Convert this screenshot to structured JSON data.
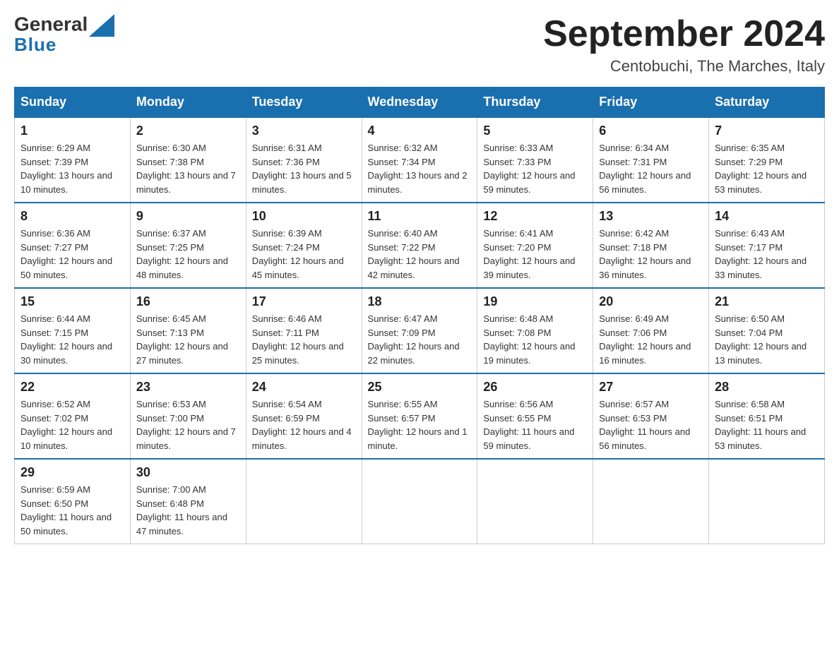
{
  "logo": {
    "general": "General",
    "blue": "Blue"
  },
  "header": {
    "title": "September 2024",
    "subtitle": "Centobuchi, The Marches, Italy"
  },
  "weekdays": [
    "Sunday",
    "Monday",
    "Tuesday",
    "Wednesday",
    "Thursday",
    "Friday",
    "Saturday"
  ],
  "weeks": [
    [
      {
        "day": "1",
        "sunrise": "6:29 AM",
        "sunset": "7:39 PM",
        "daylight": "13 hours and 10 minutes."
      },
      {
        "day": "2",
        "sunrise": "6:30 AM",
        "sunset": "7:38 PM",
        "daylight": "13 hours and 7 minutes."
      },
      {
        "day": "3",
        "sunrise": "6:31 AM",
        "sunset": "7:36 PM",
        "daylight": "13 hours and 5 minutes."
      },
      {
        "day": "4",
        "sunrise": "6:32 AM",
        "sunset": "7:34 PM",
        "daylight": "13 hours and 2 minutes."
      },
      {
        "day": "5",
        "sunrise": "6:33 AM",
        "sunset": "7:33 PM",
        "daylight": "12 hours and 59 minutes."
      },
      {
        "day": "6",
        "sunrise": "6:34 AM",
        "sunset": "7:31 PM",
        "daylight": "12 hours and 56 minutes."
      },
      {
        "day": "7",
        "sunrise": "6:35 AM",
        "sunset": "7:29 PM",
        "daylight": "12 hours and 53 minutes."
      }
    ],
    [
      {
        "day": "8",
        "sunrise": "6:36 AM",
        "sunset": "7:27 PM",
        "daylight": "12 hours and 50 minutes."
      },
      {
        "day": "9",
        "sunrise": "6:37 AM",
        "sunset": "7:25 PM",
        "daylight": "12 hours and 48 minutes."
      },
      {
        "day": "10",
        "sunrise": "6:39 AM",
        "sunset": "7:24 PM",
        "daylight": "12 hours and 45 minutes."
      },
      {
        "day": "11",
        "sunrise": "6:40 AM",
        "sunset": "7:22 PM",
        "daylight": "12 hours and 42 minutes."
      },
      {
        "day": "12",
        "sunrise": "6:41 AM",
        "sunset": "7:20 PM",
        "daylight": "12 hours and 39 minutes."
      },
      {
        "day": "13",
        "sunrise": "6:42 AM",
        "sunset": "7:18 PM",
        "daylight": "12 hours and 36 minutes."
      },
      {
        "day": "14",
        "sunrise": "6:43 AM",
        "sunset": "7:17 PM",
        "daylight": "12 hours and 33 minutes."
      }
    ],
    [
      {
        "day": "15",
        "sunrise": "6:44 AM",
        "sunset": "7:15 PM",
        "daylight": "12 hours and 30 minutes."
      },
      {
        "day": "16",
        "sunrise": "6:45 AM",
        "sunset": "7:13 PM",
        "daylight": "12 hours and 27 minutes."
      },
      {
        "day": "17",
        "sunrise": "6:46 AM",
        "sunset": "7:11 PM",
        "daylight": "12 hours and 25 minutes."
      },
      {
        "day": "18",
        "sunrise": "6:47 AM",
        "sunset": "7:09 PM",
        "daylight": "12 hours and 22 minutes."
      },
      {
        "day": "19",
        "sunrise": "6:48 AM",
        "sunset": "7:08 PM",
        "daylight": "12 hours and 19 minutes."
      },
      {
        "day": "20",
        "sunrise": "6:49 AM",
        "sunset": "7:06 PM",
        "daylight": "12 hours and 16 minutes."
      },
      {
        "day": "21",
        "sunrise": "6:50 AM",
        "sunset": "7:04 PM",
        "daylight": "12 hours and 13 minutes."
      }
    ],
    [
      {
        "day": "22",
        "sunrise": "6:52 AM",
        "sunset": "7:02 PM",
        "daylight": "12 hours and 10 minutes."
      },
      {
        "day": "23",
        "sunrise": "6:53 AM",
        "sunset": "7:00 PM",
        "daylight": "12 hours and 7 minutes."
      },
      {
        "day": "24",
        "sunrise": "6:54 AM",
        "sunset": "6:59 PM",
        "daylight": "12 hours and 4 minutes."
      },
      {
        "day": "25",
        "sunrise": "6:55 AM",
        "sunset": "6:57 PM",
        "daylight": "12 hours and 1 minute."
      },
      {
        "day": "26",
        "sunrise": "6:56 AM",
        "sunset": "6:55 PM",
        "daylight": "11 hours and 59 minutes."
      },
      {
        "day": "27",
        "sunrise": "6:57 AM",
        "sunset": "6:53 PM",
        "daylight": "11 hours and 56 minutes."
      },
      {
        "day": "28",
        "sunrise": "6:58 AM",
        "sunset": "6:51 PM",
        "daylight": "11 hours and 53 minutes."
      }
    ],
    [
      {
        "day": "29",
        "sunrise": "6:59 AM",
        "sunset": "6:50 PM",
        "daylight": "11 hours and 50 minutes."
      },
      {
        "day": "30",
        "sunrise": "7:00 AM",
        "sunset": "6:48 PM",
        "daylight": "11 hours and 47 minutes."
      },
      null,
      null,
      null,
      null,
      null
    ]
  ]
}
